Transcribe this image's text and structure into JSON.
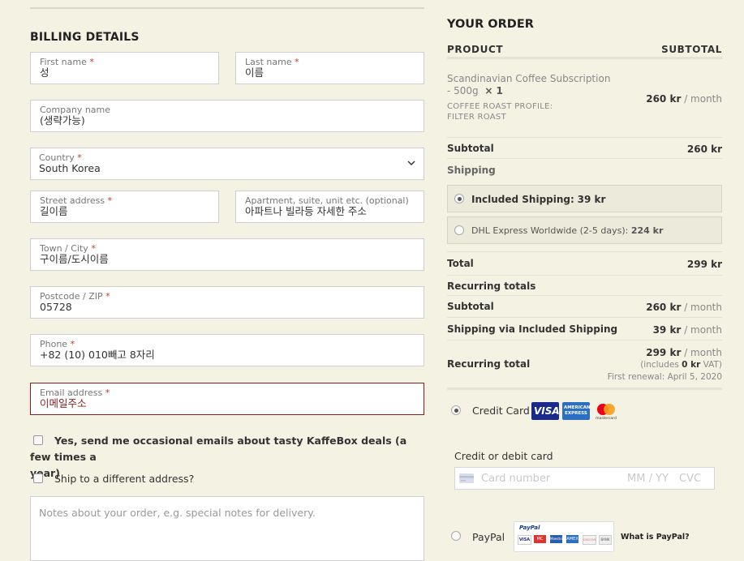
{
  "billing": {
    "title": "BILLING DETAILS",
    "required_mark": "*",
    "first_name": {
      "label": "First name",
      "value": "성"
    },
    "last_name": {
      "label": "Last name",
      "value": "이름"
    },
    "company": {
      "label": "Company name",
      "value": "(생략가능)"
    },
    "country": {
      "label": "Country",
      "value": "South Korea"
    },
    "street": {
      "label": "Street address",
      "value": "길이름"
    },
    "apartment": {
      "label": "Apartment, suite, unit etc. (optional)",
      "value": "아파트나 빌라등 자세한 주소"
    },
    "city": {
      "label": "Town / City",
      "value": "구이름/도시이름"
    },
    "postcode": {
      "label": "Postcode / ZIP",
      "value": "05728"
    },
    "phone": {
      "label": "Phone",
      "value": "+82 (10) 010빼고 8자리"
    },
    "email": {
      "label": "Email address",
      "value": "이메일주소"
    },
    "newsletter_text_bold": "Yes, send me occasional emails about tasty KaffeBox deals (a few times a",
    "newsletter_text_cont": "year)",
    "ship_different": "Ship to a different address?",
    "notes_placeholder": "Notes about your order, e.g. special notes for delivery."
  },
  "order": {
    "title": "YOUR ORDER",
    "col_product": "PRODUCT",
    "col_subtotal": "SUBTOTAL",
    "item": {
      "name_line1": "Scandinavian Coffee Subscription",
      "name_line2": "- 500g",
      "qty": "× 1",
      "meta_label": "COFFEE ROAST PROFILE:",
      "meta_value": "FILTER ROAST",
      "price": "260 kr",
      "period": "/ month"
    },
    "subtotal_label": "Subtotal",
    "subtotal_value": "260 kr",
    "shipping_label": "Shipping",
    "shipping_options": [
      {
        "label": "Included Shipping:",
        "price": "39 kr",
        "selected": true
      },
      {
        "label": "DHL Express Worldwide (2-5 days):",
        "price": "224 kr",
        "selected": false
      }
    ],
    "total_label": "Total",
    "total_value": "299 kr",
    "recurring_title": "Recurring totals",
    "rec_subtotal_label": "Subtotal",
    "rec_subtotal_value": "260 kr",
    "rec_shipping_label": "Shipping via Included Shipping",
    "rec_shipping_value": "39 kr",
    "rec_total_label": "Recurring total",
    "rec_total_value": "299 kr",
    "period": "/ month",
    "vat_prefix": "(includes",
    "vat_amount": "0 kr",
    "vat_suffix": "VAT)",
    "first_renewal": "First renewal: April 5, 2020"
  },
  "payment": {
    "credit_card_label": "Credit Card",
    "card_section_title": "Credit or debit card",
    "card_number_placeholder": "Card number",
    "expiry_placeholder": "MM / YY",
    "cvc_placeholder": "CVC",
    "visa_text": "VISA",
    "amex_text": "AMERICAN EXPRESS",
    "mastercard_text": "mastercard",
    "paypal_label": "PayPal",
    "paypal_logo_text": "PayPal",
    "paypal_cards": [
      "VISA",
      "MC",
      "Maestro",
      "AMEX",
      "DISCOVER",
      "BANK"
    ],
    "what_is_paypal": "What is PayPal?"
  }
}
